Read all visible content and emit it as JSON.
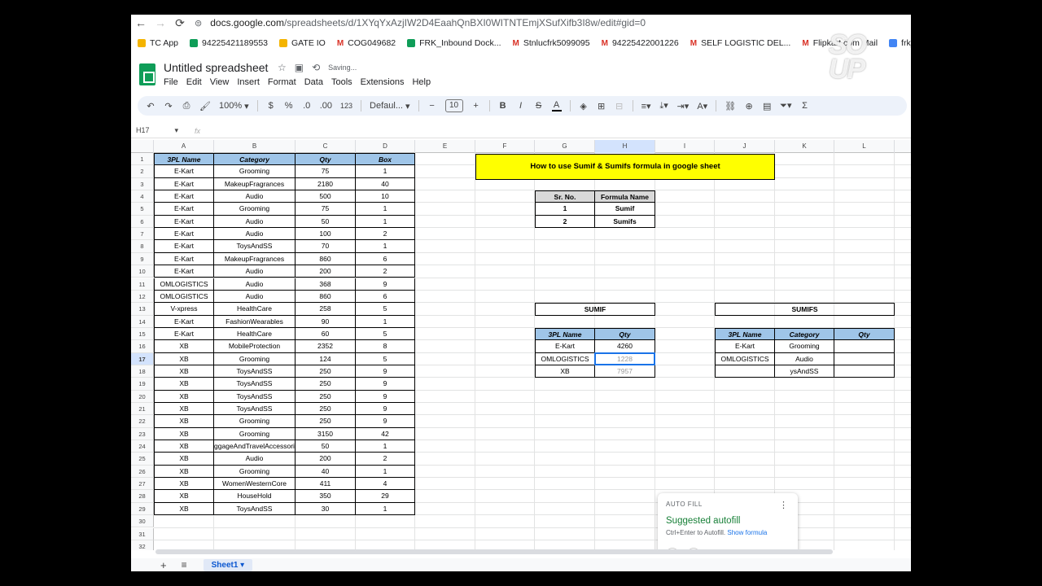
{
  "browser": {
    "url_main": "docs.google.com",
    "url_path": "/spreadsheets/d/1XYqYxAzjIW2D4EaahQnBXI0WITNTEmjXSufXifb3I8w/edit#gid=0",
    "bookmarks": [
      {
        "label": "TC App",
        "color": "#f4b400"
      },
      {
        "label": "94225421189553",
        "color": "#0f9d58"
      },
      {
        "label": "GATE IO",
        "color": "#f4b400"
      },
      {
        "label": "COG049682",
        "color": "gmail"
      },
      {
        "label": "FRK_Inbound Dock...",
        "color": "#0f9d58"
      },
      {
        "label": "Stnlucfrk5099095",
        "color": "gmail"
      },
      {
        "label": "94225422001226",
        "color": "gmail"
      },
      {
        "label": "SELF LOGISTIC DEL...",
        "color": "gmail"
      },
      {
        "label": "Flipkart.com Mail",
        "color": "gmail"
      },
      {
        "label": "frk_bts",
        "color": "#4285f4"
      }
    ]
  },
  "doc": {
    "title": "Untitled spreadsheet",
    "saving": "Saving...",
    "menu": [
      "File",
      "Edit",
      "View",
      "Insert",
      "Format",
      "Data",
      "Tools",
      "Extensions",
      "Help"
    ]
  },
  "toolbar": {
    "zoom": "100%",
    "currency": "$",
    "percent": "%",
    "dec_less": ".0",
    "dec_more": ".00",
    "number_format": "123",
    "font": "Defaul...",
    "font_size": "10"
  },
  "formula_bar": {
    "name_box": "H17",
    "fx": "fx"
  },
  "columns": [
    "A",
    "B",
    "C",
    "D",
    "E",
    "F",
    "G",
    "H",
    "I",
    "J",
    "K",
    "L"
  ],
  "rows": [
    "1",
    "2",
    "3",
    "4",
    "5",
    "6",
    "7",
    "8",
    "9",
    "10",
    "11",
    "12",
    "13",
    "14",
    "15",
    "16",
    "17",
    "18",
    "19",
    "20",
    "21",
    "22",
    "23",
    "24",
    "25",
    "26",
    "27",
    "28",
    "29",
    "30",
    "31",
    "32"
  ],
  "main_table": {
    "headers": [
      "3PL Name",
      "Category",
      "Qty",
      "Box"
    ],
    "rows": [
      [
        "E-Kart",
        "Grooming",
        "75",
        "1"
      ],
      [
        "E-Kart",
        "MakeupFragrances",
        "2180",
        "40"
      ],
      [
        "E-Kart",
        "Audio",
        "500",
        "10"
      ],
      [
        "E-Kart",
        "Grooming",
        "75",
        "1"
      ],
      [
        "E-Kart",
        "Audio",
        "50",
        "1"
      ],
      [
        "E-Kart",
        "Audio",
        "100",
        "2"
      ],
      [
        "E-Kart",
        "ToysAndSS",
        "70",
        "1"
      ],
      [
        "E-Kart",
        "MakeupFragrances",
        "860",
        "6"
      ],
      [
        "E-Kart",
        "Audio",
        "200",
        "2"
      ],
      [
        "OMLOGISTICS",
        "Audio",
        "368",
        "9"
      ],
      [
        "OMLOGISTICS",
        "Audio",
        "860",
        "6"
      ],
      [
        "V-xpress",
        "HealthCare",
        "258",
        "5"
      ],
      [
        "E-Kart",
        "FashionWearables",
        "90",
        "1"
      ],
      [
        "E-Kart",
        "HealthCare",
        "60",
        "5"
      ],
      [
        "XB",
        "MobileProtection",
        "2352",
        "8"
      ],
      [
        "XB",
        "Grooming",
        "124",
        "5"
      ],
      [
        "XB",
        "ToysAndSS",
        "250",
        "9"
      ],
      [
        "XB",
        "ToysAndSS",
        "250",
        "9"
      ],
      [
        "XB",
        "ToysAndSS",
        "250",
        "9"
      ],
      [
        "XB",
        "ToysAndSS",
        "250",
        "9"
      ],
      [
        "XB",
        "Grooming",
        "250",
        "9"
      ],
      [
        "XB",
        "Grooming",
        "3150",
        "42"
      ],
      [
        "XB",
        "ggageAndTravelAccessori",
        "50",
        "1"
      ],
      [
        "XB",
        "Audio",
        "200",
        "2"
      ],
      [
        "XB",
        "Grooming",
        "40",
        "1"
      ],
      [
        "XB",
        "WomenWesternCore",
        "411",
        "4"
      ],
      [
        "XB",
        "HouseHold",
        "350",
        "29"
      ],
      [
        "XB",
        "ToysAndSS",
        "30",
        "1"
      ]
    ]
  },
  "banner": "How to use Sumif & Sumifs formula in google sheet",
  "formula_table": {
    "headers": [
      "Sr. No.",
      "Formula Name"
    ],
    "rows": [
      [
        "1",
        "Sumif"
      ],
      [
        "2",
        "Sumifs"
      ]
    ]
  },
  "sumif": {
    "title": "SUMIF",
    "headers": [
      "3PL Name",
      "Qty"
    ],
    "rows": [
      [
        "E-Kart",
        "4260"
      ],
      [
        "OMLOGISTICS",
        "1228"
      ],
      [
        "XB",
        "7957"
      ]
    ]
  },
  "sumifs": {
    "title": "SUMIFS",
    "headers": [
      "3PL Name",
      "Category",
      "Qty"
    ],
    "rows": [
      [
        "E-Kart",
        "Grooming",
        ""
      ],
      [
        "OMLOGISTICS",
        "Audio",
        ""
      ],
      [
        "",
        "ysAndSS",
        ""
      ]
    ]
  },
  "autofill": {
    "label": "AUTO FILL",
    "title": "Suggested autofill",
    "hint": "Ctrl+Enter to Autofill.",
    "link": "Show formula",
    "accept": "✓",
    "dismiss": "✕"
  },
  "sheet_tab": "Sheet1",
  "watermark": "SO\nUP"
}
